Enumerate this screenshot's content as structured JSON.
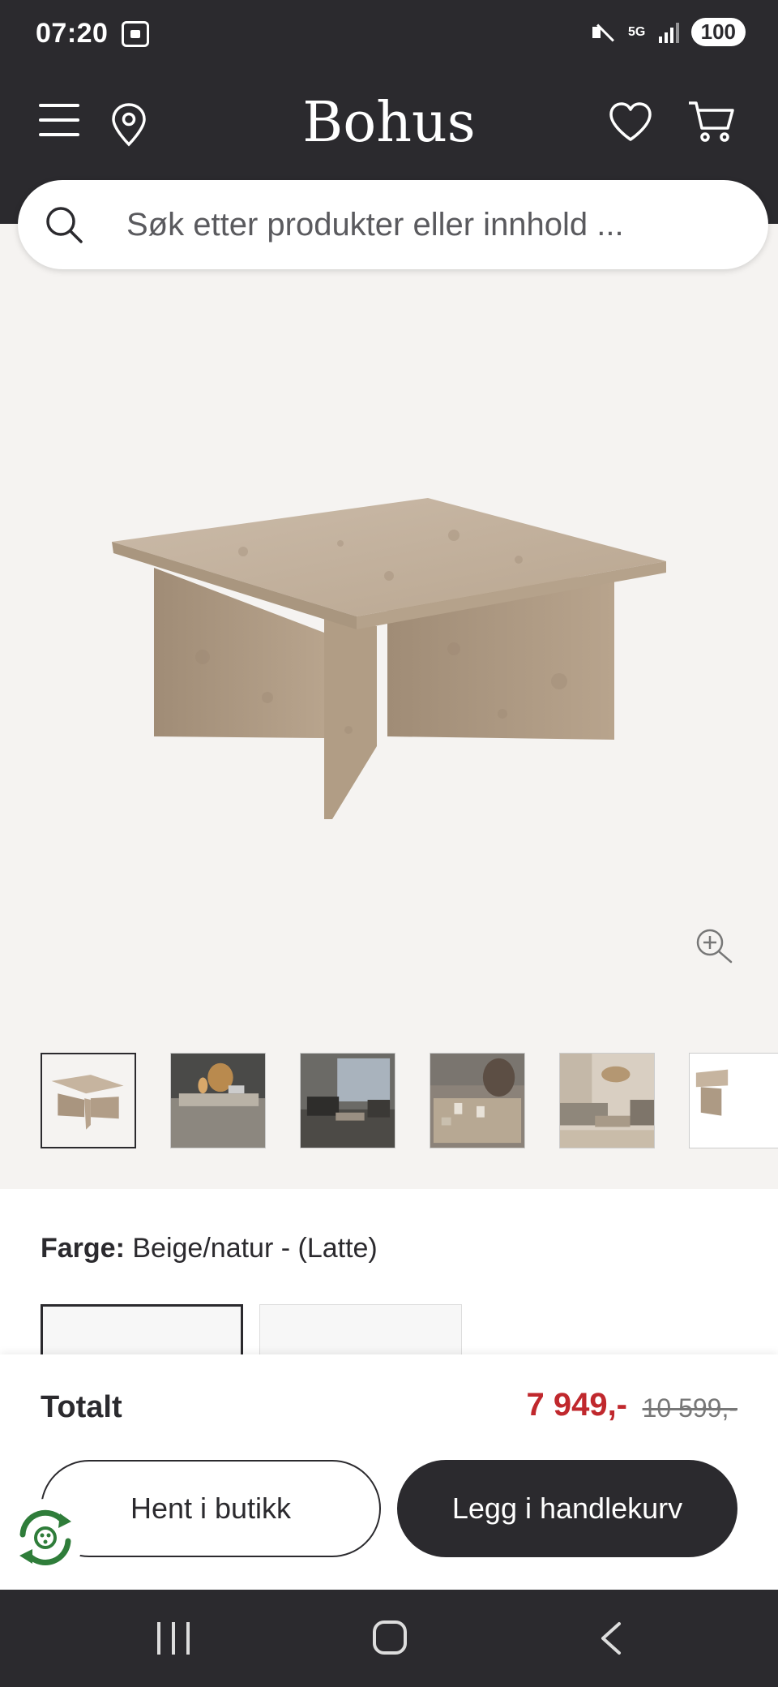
{
  "status_bar": {
    "time": "07:20",
    "network": "5G",
    "battery": "100"
  },
  "header": {
    "logo": "Bohus"
  },
  "search": {
    "placeholder": "Søk etter produkter eller innhold ..."
  },
  "gallery": {
    "thumbnail_count": 6,
    "selected_index": 0
  },
  "details": {
    "color_label": "Farge:",
    "color_value": "Beige/natur - (Latte)"
  },
  "purchase": {
    "total_label": "Totalt",
    "price": "7 949,-",
    "old_price": "10 599,-",
    "pickup_button": "Hent i butikk",
    "cart_button": "Legg i handlekurv"
  },
  "colors": {
    "dark": "#2b2a2e",
    "sale_red": "#c0282d",
    "page_bg": "#f5f3f1"
  }
}
